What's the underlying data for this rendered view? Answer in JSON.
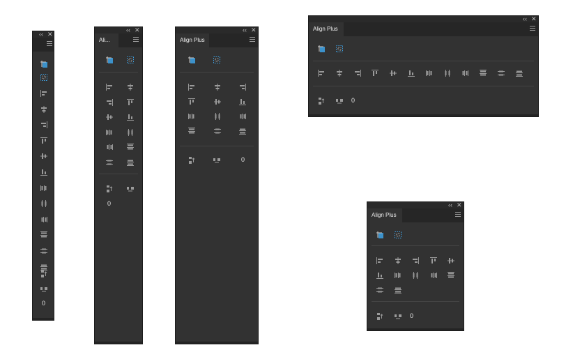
{
  "panels": [
    {
      "id": "p1",
      "tab_title": ""
    },
    {
      "id": "p2",
      "tab_title": "Ali..."
    },
    {
      "id": "p3",
      "tab_title": "Align Plus"
    },
    {
      "id": "p4",
      "tab_title": "Align Plus"
    },
    {
      "id": "p5",
      "tab_title": "Align Plus"
    }
  ],
  "controls": {
    "collapse_glyph": "‹‹",
    "close_glyph": "✕"
  },
  "spacing": {
    "value": "0"
  },
  "icons": {
    "align_to_key_object": "align-to-key-object-icon",
    "align_to_selection": "align-to-selection-icon",
    "distribute_spacing_vertical": "distribute-spacing-vertical-icon",
    "distribute_spacing_horizontal": "distribute-spacing-horizontal-icon"
  },
  "colors": {
    "panel_bg": "#323232",
    "accent": "#3ea3e6",
    "icon": "#9a9a9a"
  }
}
